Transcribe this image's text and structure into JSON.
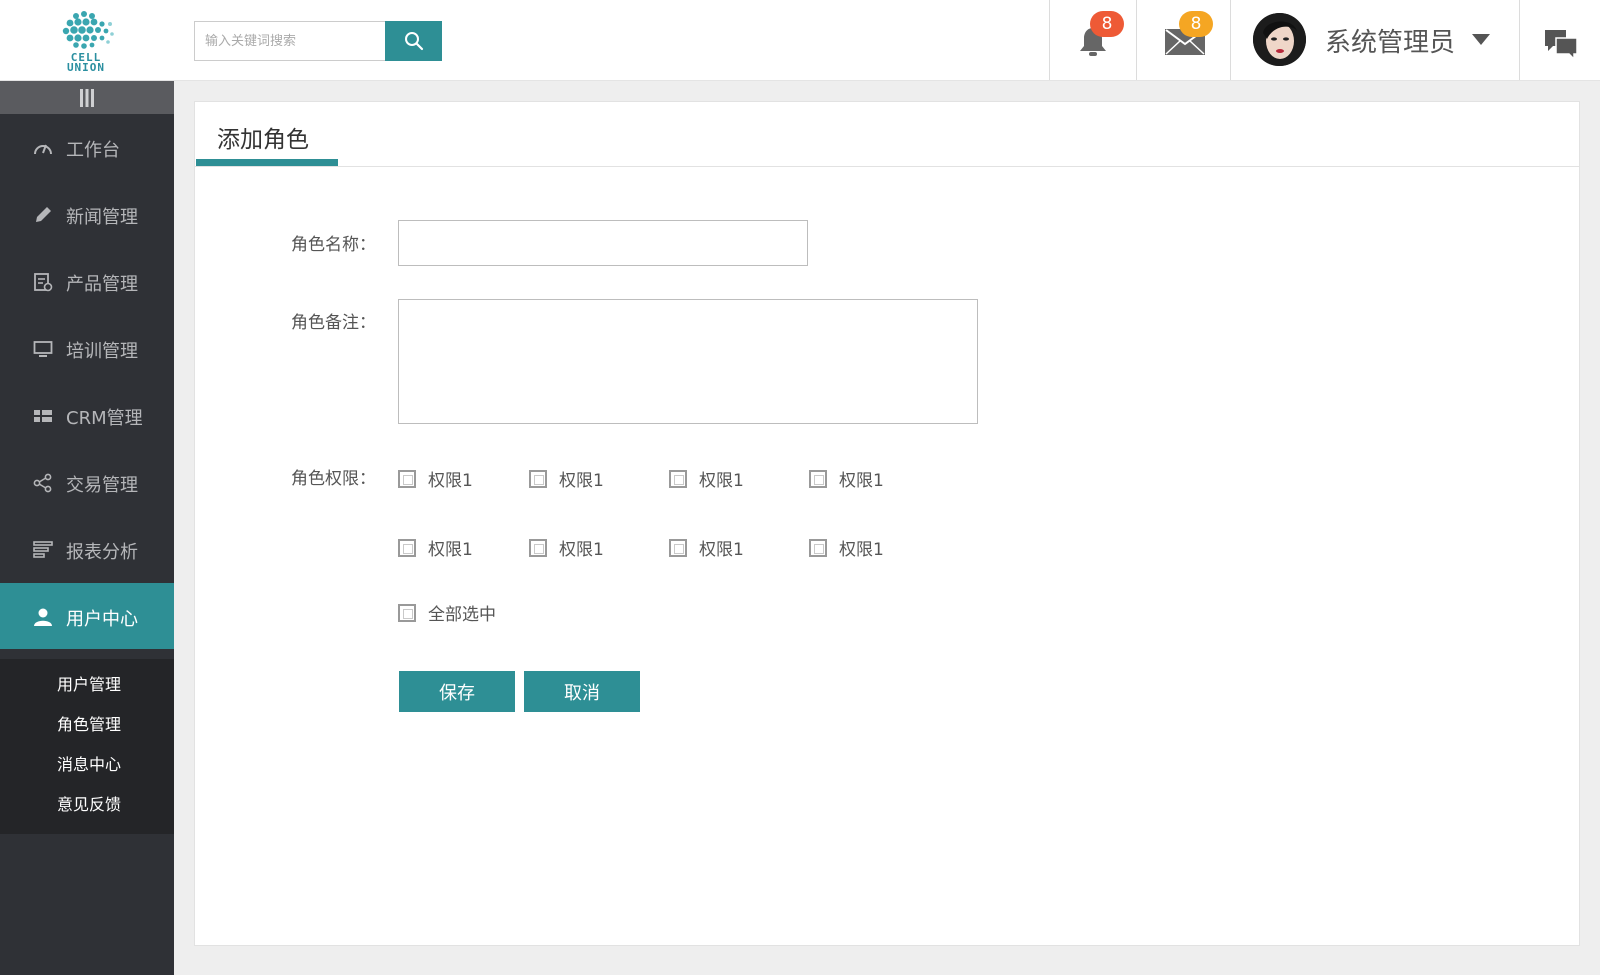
{
  "header": {
    "logo_text": "CELL UNION",
    "search": {
      "placeholder": "输入关键词搜索"
    },
    "notifications": {
      "count": "8"
    },
    "messages": {
      "count": "8"
    },
    "user": {
      "name": "系统管理员"
    }
  },
  "sidebar": {
    "items": [
      {
        "label": "工作台",
        "icon": "gauge-icon"
      },
      {
        "label": "新闻管理",
        "icon": "pencil-icon"
      },
      {
        "label": "产品管理",
        "icon": "product-icon"
      },
      {
        "label": "培训管理",
        "icon": "monitor-icon"
      },
      {
        "label": "CRM管理",
        "icon": "grid-icon"
      },
      {
        "label": "交易管理",
        "icon": "share-icon"
      },
      {
        "label": "报表分析",
        "icon": "report-icon"
      },
      {
        "label": "用户中心",
        "icon": "user-icon",
        "active": true
      }
    ],
    "submenu": [
      "用户管理",
      "角色管理",
      "消息中心",
      "意见反馈"
    ]
  },
  "main": {
    "title": "添加角色",
    "form": {
      "name_label": "角色名称：",
      "name_value": "",
      "note_label": "角色备注：",
      "note_value": "",
      "perm_label": "角色权限：",
      "permissions": [
        "权限1",
        "权限1",
        "权限1",
        "权限1",
        "权限1",
        "权限1",
        "权限1",
        "权限1"
      ],
      "select_all": "全部选中",
      "save": "保存",
      "cancel": "取消"
    }
  },
  "colors": {
    "accent": "#2e8f95",
    "sidebar_bg": "#2f3136",
    "badge_red": "#ee5a36",
    "badge_orange": "#f5a623"
  }
}
